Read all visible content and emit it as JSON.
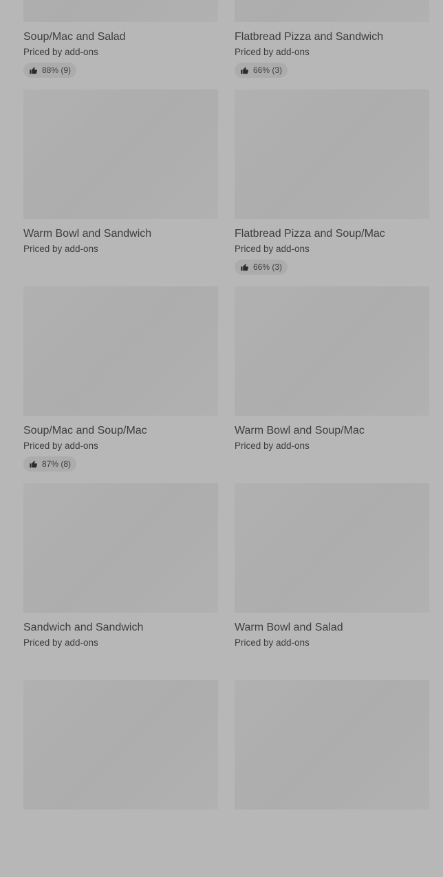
{
  "items": [
    {
      "title": "Soup/Mac and Salad",
      "price": "Priced by add-ons",
      "rating": "88% (9)"
    },
    {
      "title": "Flatbread Pizza and Sandwich",
      "price": "Priced by add-ons",
      "rating": "66% (3)"
    },
    {
      "title": "Warm Bowl and Sandwich",
      "price": "Priced by add-ons",
      "rating": null
    },
    {
      "title": "Flatbread Pizza and Soup/Mac",
      "price": "Priced by add-ons",
      "rating": "66% (3)"
    },
    {
      "title": "Soup/Mac and Soup/Mac",
      "price": "Priced by add-ons",
      "rating": "87% (8)"
    },
    {
      "title": "Warm Bowl and Soup/Mac",
      "price": "Priced by add-ons",
      "rating": null
    },
    {
      "title": "Sandwich and Sandwich",
      "price": "Priced by add-ons",
      "rating": null
    },
    {
      "title": "Warm Bowl and Salad",
      "price": "Priced by add-ons",
      "rating": null
    },
    {
      "title": "",
      "price": "",
      "rating": null
    },
    {
      "title": "",
      "price": "",
      "rating": null
    }
  ],
  "icons": {
    "rating": "thumbs-up-icon"
  }
}
